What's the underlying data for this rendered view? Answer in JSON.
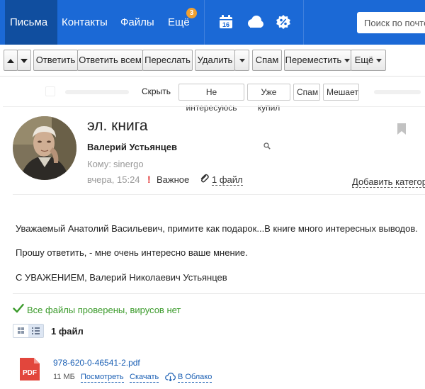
{
  "nav": {
    "tabs": [
      "Письма",
      "Контакты",
      "Файлы",
      "Ещё"
    ],
    "more_badge": "3",
    "calendar_day": "16",
    "icons": [
      "calendar-icon",
      "cloud-icon",
      "percent-icon"
    ],
    "search_placeholder": "Поиск по почте"
  },
  "toolbar": {
    "up": "up-arrow",
    "down": "down-arrow",
    "reply": "Ответить",
    "reply_all": "Ответить всем",
    "forward": "Переслать",
    "delete": "Удалить",
    "spam": "Спам",
    "move": "Переместить",
    "more": "Ещё"
  },
  "suggest": {
    "hide": "Скрыть",
    "chips": [
      "Не интересуюсь",
      "Уже купил",
      "Спам",
      "Мешает"
    ]
  },
  "message": {
    "subject": "эл. книга",
    "sender": "Валерий Устьянцев",
    "to_label": "Кому:",
    "to_value": "sinergo",
    "date": "вчера, 15:24",
    "important_mark": "!",
    "important_label": "Важное",
    "files_link": "1 файл",
    "add_category": "Добавить категорию",
    "body": [
      "Уважаемый Анатолий Васильевич, примите как подарок...В книге много интересных выводов.",
      "Прошу ответить, - мне очень интересно ваше мнение.",
      "С УВАЖЕНИЕМ, Валерий Николаевич Устьянцев"
    ]
  },
  "attachments": {
    "av_status": "Все файлы проверены, вирусов нет",
    "count_label": "1 файл",
    "file": {
      "type_label": "PDF",
      "name": "978-620-0-46541-2.pdf",
      "size": "11 МБ",
      "view": "Посмотреть",
      "download": "Скачать",
      "to_cloud": "В Облако"
    }
  },
  "colors": {
    "nav_bg": "#1b69d6",
    "nav_active": "#104e9f",
    "badge": "#f0a030",
    "link": "#1a5fb4",
    "ok_green": "#3a9a2a",
    "important_red": "#e03030",
    "pdf_red": "#e2463c"
  }
}
